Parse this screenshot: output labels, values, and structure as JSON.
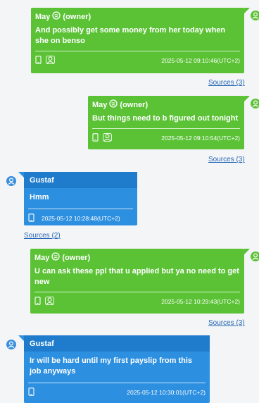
{
  "messages": [
    {
      "sender": "May",
      "role": "(owner)",
      "text": "And possibly get some money from her today when she on benso",
      "timestamp": "2025-05-12 09:10:46(UTC+2)",
      "sources": "Sources (3)"
    },
    {
      "sender": "May",
      "role": "(owner)",
      "text": "But things need to b figured out tonight",
      "timestamp": "2025-05-12 09:10:54(UTC+2)",
      "sources": "Sources (3)"
    },
    {
      "sender": "Gustaf",
      "text": "Hmm",
      "timestamp": "2025-05-12 10:28:48(UTC+2)",
      "sources": "Sources (2)"
    },
    {
      "sender": "May",
      "role": "(owner)",
      "text": "U can ask these ppl that u applied but ya no need to get new",
      "timestamp": "2025-05-12 10:29:43(UTC+2)",
      "sources": "Sources (3)"
    },
    {
      "sender": "Gustaf",
      "text": "Ir will be hard until my first payslip from this job anyways",
      "timestamp": "2025-05-12 10:30:01(UTC+2)"
    }
  ],
  "colors": {
    "outgoing": "#5bc236",
    "incoming": "#2d8fe0",
    "link": "#2566b3"
  },
  "icons": {
    "device": "phone-icon",
    "participants": "participants-icon",
    "emoji": "sad-emoji-icon",
    "avatar": "user-avatar-icon"
  }
}
